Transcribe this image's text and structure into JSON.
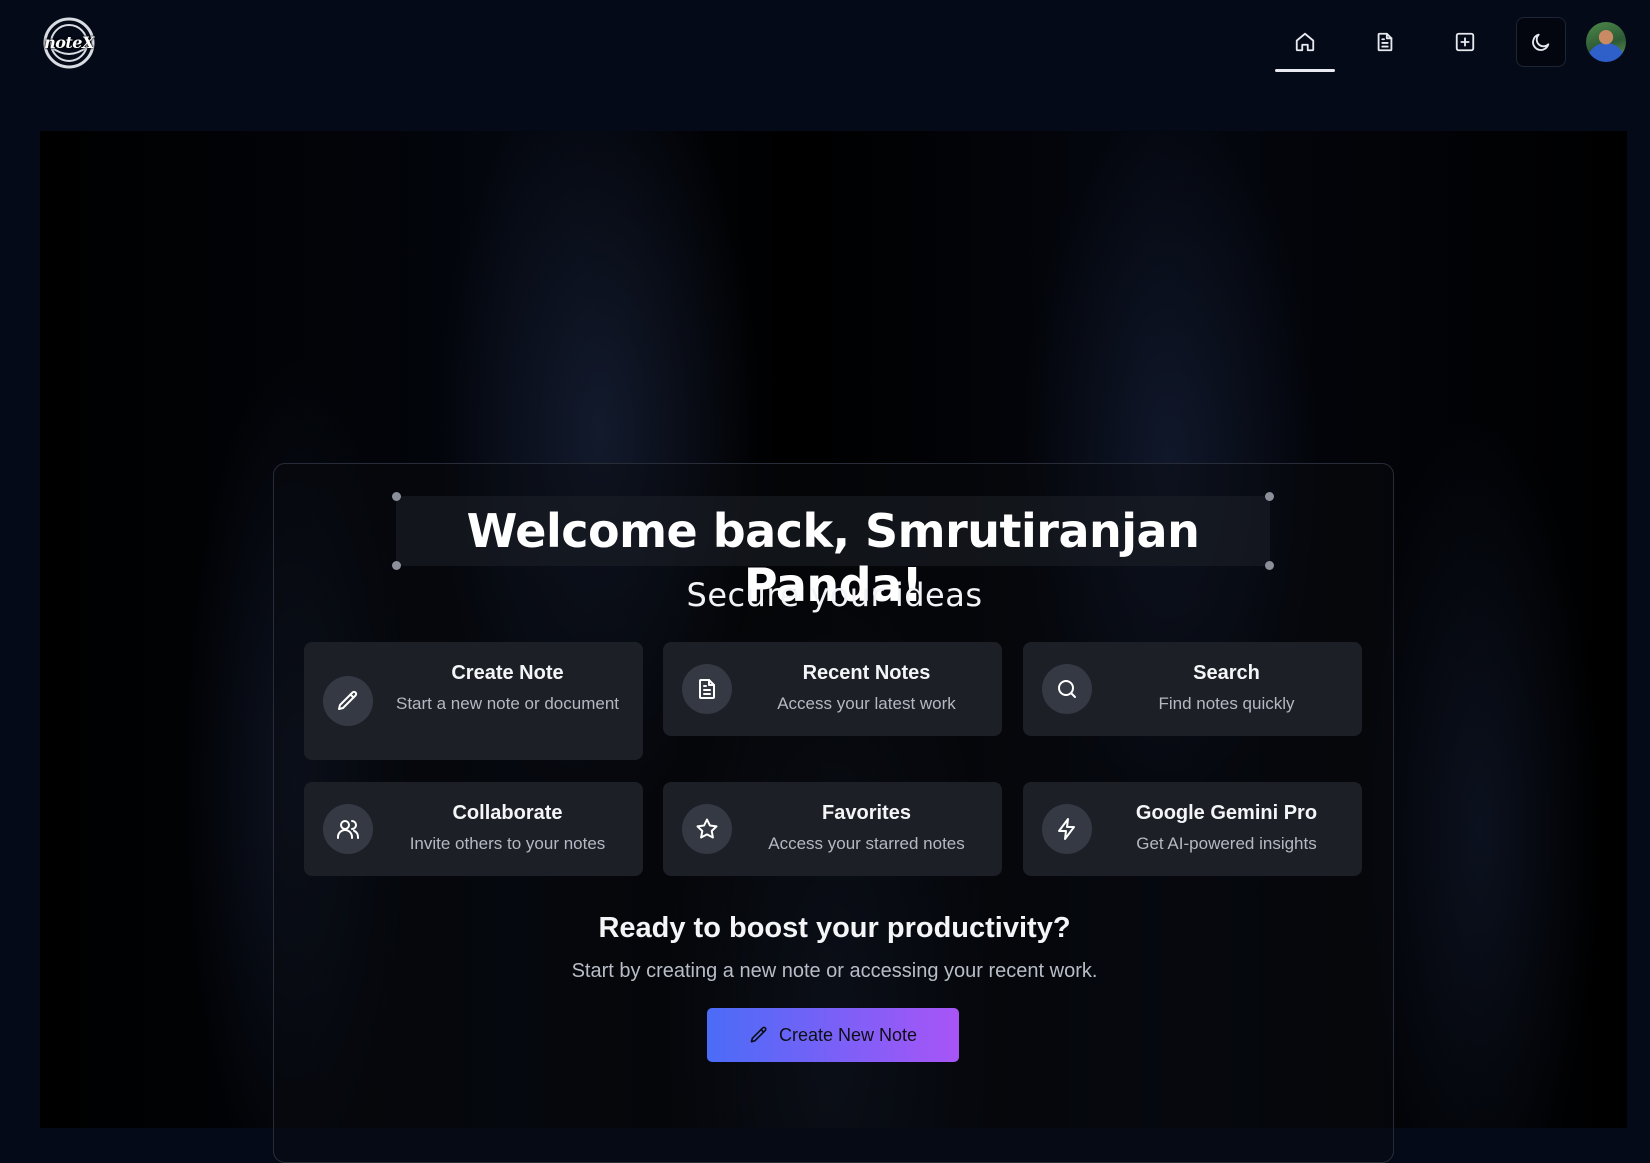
{
  "app": {
    "logo_text": "noteX"
  },
  "nav": {
    "items": [
      {
        "icon": "home-icon",
        "active": true
      },
      {
        "icon": "document-icon",
        "active": false
      },
      {
        "icon": "add-square-icon",
        "active": false
      }
    ],
    "theme_icon": "moon-icon",
    "avatar": "user-avatar"
  },
  "hero": {
    "welcome": "Welcome back, Smrutiranjan Panda!",
    "tagline": "Secure your ideas",
    "features": [
      {
        "icon": "pencil-icon",
        "title": "Create Note",
        "desc": "Start a new note or document"
      },
      {
        "icon": "document-icon",
        "title": "Recent Notes",
        "desc": "Access your latest work"
      },
      {
        "icon": "search-icon",
        "title": "Search",
        "desc": "Find notes quickly"
      },
      {
        "icon": "users-icon",
        "title": "Collaborate",
        "desc": "Invite others to your notes"
      },
      {
        "icon": "star-icon",
        "title": "Favorites",
        "desc": "Access your starred notes"
      },
      {
        "icon": "lightning-icon",
        "title": "Google Gemini Pro",
        "desc": "Get AI-powered insights"
      }
    ],
    "cta_title": "Ready to boost your productivity?",
    "cta_sub": "Start by creating a new note or accessing your recent work.",
    "cta_button": "Create New Note"
  },
  "colors": {
    "background": "#050a18",
    "card": "#1c1f26",
    "cta_gradient_start": "#4a6cf7",
    "cta_gradient_end": "#a855f7"
  }
}
